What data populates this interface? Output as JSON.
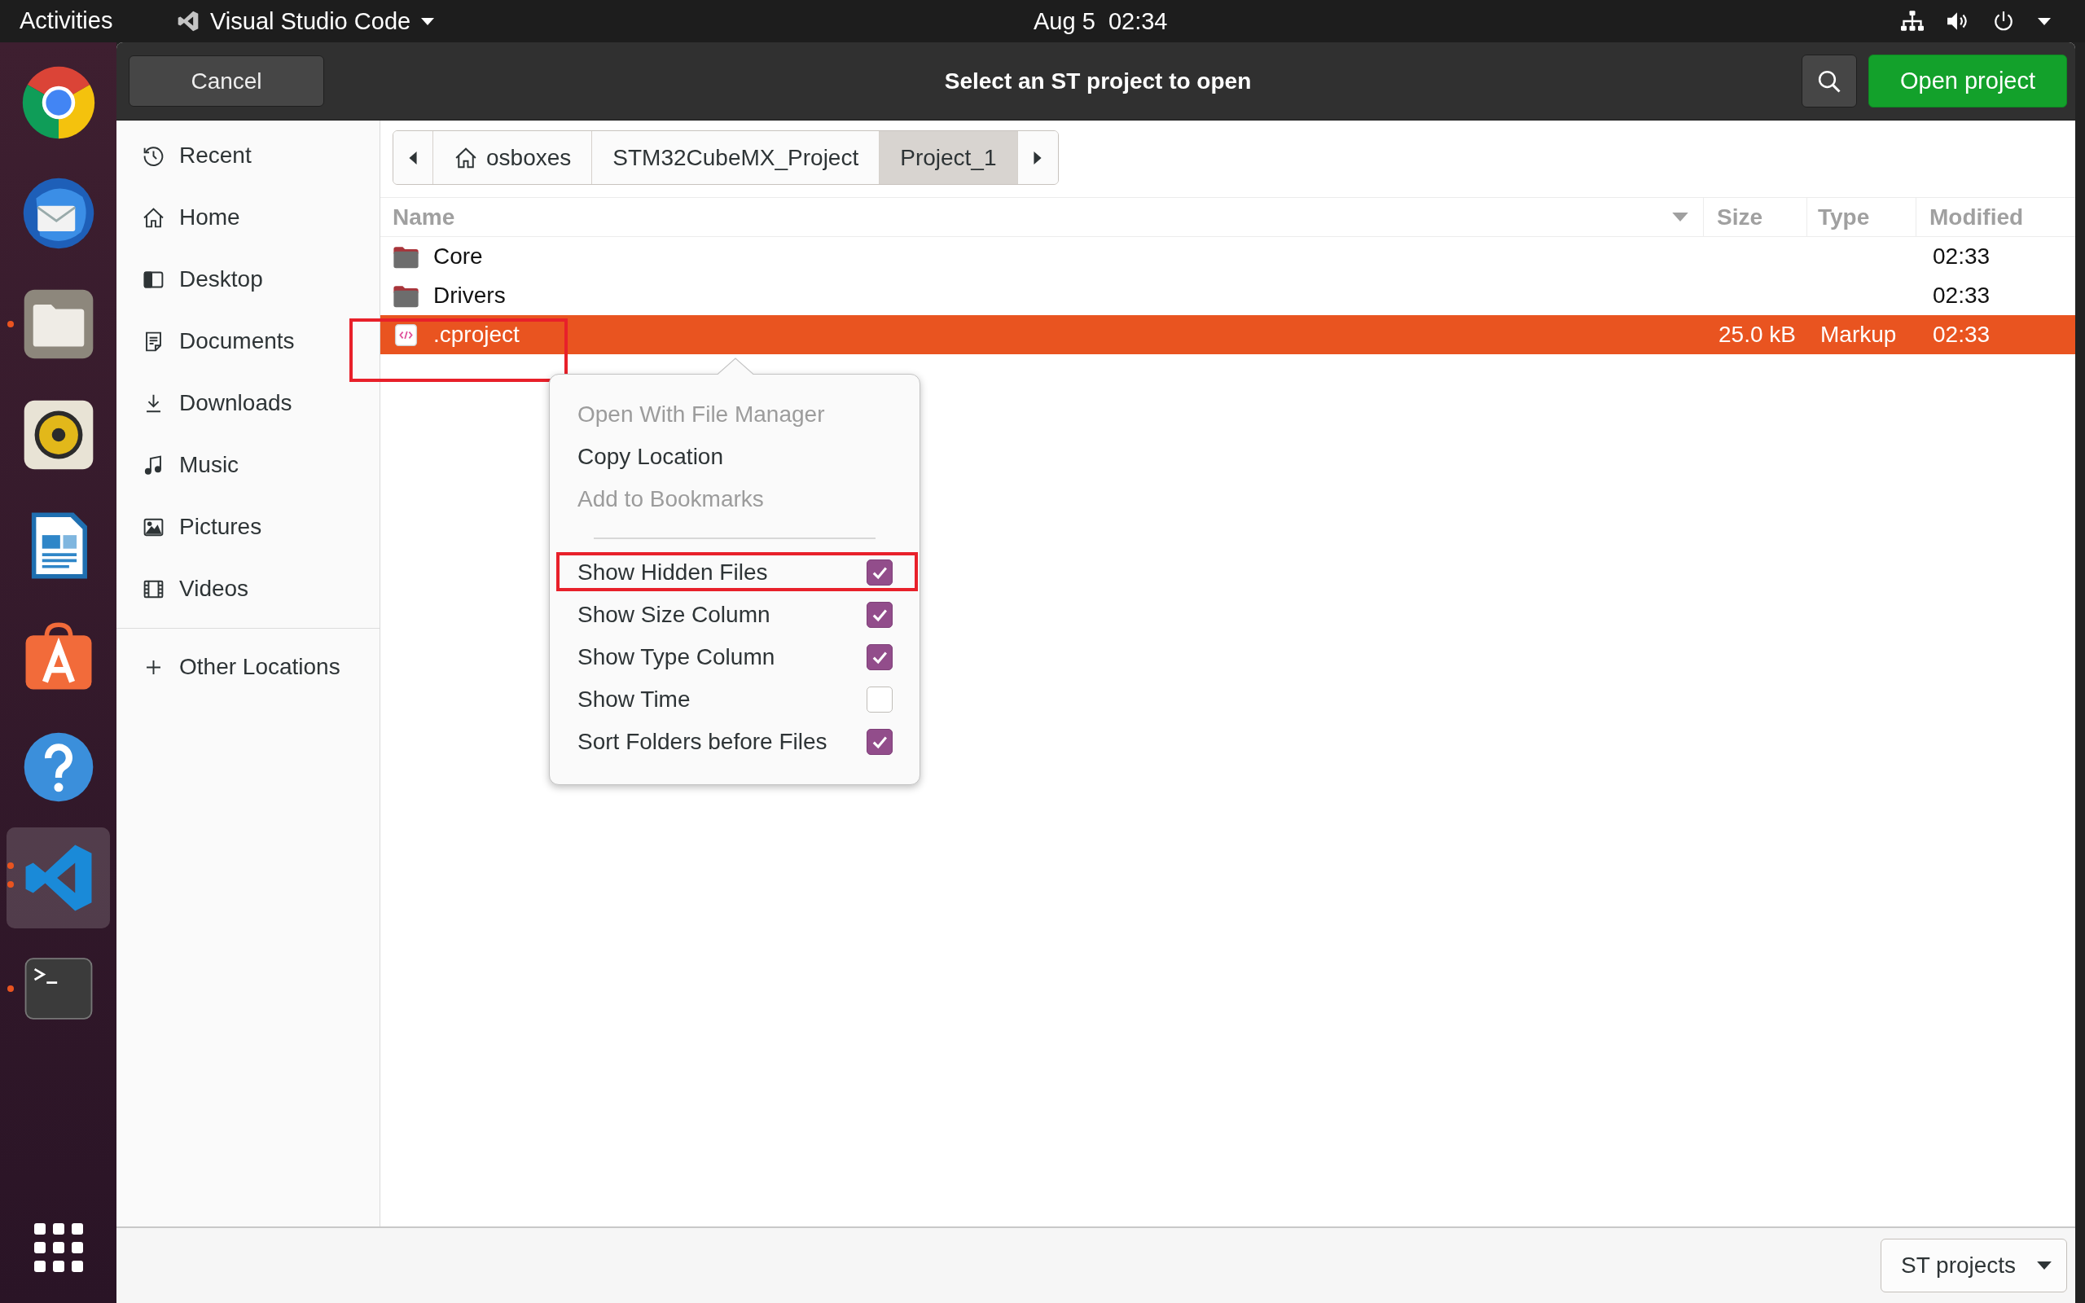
{
  "top_bar": {
    "activities": "Activities",
    "app_menu": "Visual Studio Code",
    "clock": "Aug 5  02:34"
  },
  "dock": {
    "items": [
      {
        "kind": "browser",
        "running": false,
        "multi_window": false,
        "focused": false
      },
      {
        "kind": "mail",
        "running": false,
        "multi_window": false,
        "focused": false
      },
      {
        "kind": "files",
        "running": true,
        "multi_window": false,
        "focused": false
      },
      {
        "kind": "music",
        "running": false,
        "multi_window": false,
        "focused": false
      },
      {
        "kind": "writer",
        "running": false,
        "multi_window": false,
        "focused": false
      },
      {
        "kind": "software",
        "running": false,
        "multi_window": false,
        "focused": false
      },
      {
        "kind": "help",
        "running": false,
        "multi_window": false,
        "focused": false
      },
      {
        "kind": "editor",
        "running": true,
        "multi_window": true,
        "focused": true
      },
      {
        "kind": "terminal",
        "running": true,
        "multi_window": false,
        "focused": false
      }
    ]
  },
  "dialog": {
    "cancel": "Cancel",
    "title": "Select an ST project to open",
    "confirm": "Open project"
  },
  "sidebar": {
    "items": [
      {
        "kind": "recent",
        "label": "Recent",
        "selected": false
      },
      {
        "kind": "home",
        "label": "Home",
        "selected": false
      },
      {
        "kind": "desktop",
        "label": "Desktop",
        "selected": false
      },
      {
        "kind": "documents",
        "label": "Documents",
        "selected": false
      },
      {
        "kind": "downloads",
        "label": "Downloads",
        "selected": false
      },
      {
        "kind": "music",
        "label": "Music",
        "selected": false
      },
      {
        "kind": "pictures",
        "label": "Pictures",
        "selected": false
      },
      {
        "kind": "videos",
        "label": "Videos",
        "selected": false
      }
    ],
    "other_locations": "Other Locations"
  },
  "path_bar": {
    "segments": [
      {
        "kind": "home",
        "label": "osboxes",
        "selected": false
      },
      {
        "kind": "folder",
        "label": "STM32CubeMX_Project",
        "selected": false
      },
      {
        "kind": "folder",
        "label": "Project_1",
        "selected": true
      }
    ]
  },
  "file_list": {
    "columns": [
      {
        "label": "Name",
        "sorted": true
      },
      {
        "label": "Size",
        "sorted": false
      },
      {
        "label": "Type",
        "sorted": false
      },
      {
        "label": "Modified",
        "sorted": false
      }
    ],
    "rows": [
      {
        "kind": "folder",
        "name": "Core",
        "modified": "02:33",
        "selected": false,
        "outlined": false
      },
      {
        "kind": "folder",
        "name": "Drivers",
        "modified": "02:33",
        "selected": false,
        "outlined": false
      },
      {
        "kind": "markup",
        "name": ".cproject",
        "size": "25.0 kB",
        "type": "Markup",
        "modified": "02:33",
        "selected": true,
        "outlined": true
      }
    ]
  },
  "context_menu": {
    "actions": [
      {
        "label": "Open With File Manager",
        "disabled": true
      },
      {
        "label": "Copy Location",
        "disabled": false
      },
      {
        "label": "Add to Bookmarks",
        "disabled": true
      }
    ],
    "toggles": [
      {
        "label": "Show Hidden Files",
        "checked": true,
        "outlined": true
      },
      {
        "label": "Show Size Column",
        "checked": true,
        "outlined": false
      },
      {
        "label": "Show Type Column",
        "checked": true,
        "outlined": false
      },
      {
        "label": "Show Time",
        "checked": false,
        "outlined": false
      },
      {
        "label": "Sort Folders before Files",
        "checked": true,
        "outlined": false
      }
    ]
  },
  "file_filter": {
    "value": "ST projects"
  }
}
